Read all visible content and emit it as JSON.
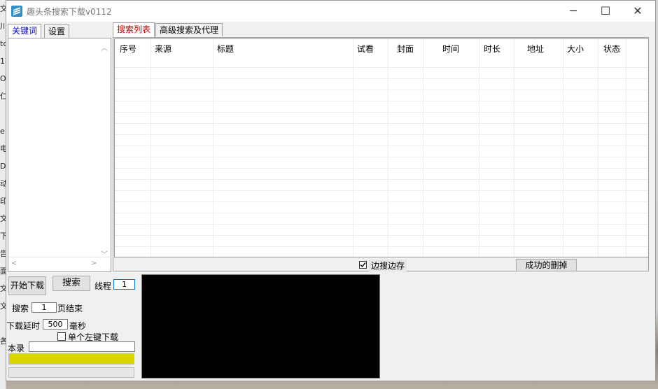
{
  "window": {
    "title": "趣头条搜索下载v0112",
    "controls": {
      "minimize": "─",
      "maximize": "☐",
      "close": "✕"
    }
  },
  "left_tabs": [
    {
      "label": "关键词",
      "active": true,
      "color": "#0000cc"
    },
    {
      "label": "设置",
      "active": false
    }
  ],
  "right_tabs": [
    {
      "label": "搜索列表",
      "active": true,
      "color": "#cc0000"
    },
    {
      "label": "高级搜索及代理",
      "active": false
    }
  ],
  "table": {
    "columns": [
      "序号",
      "来源",
      "标题",
      "试看",
      "封面",
      "时间",
      "时长",
      "地址",
      "大小",
      "状态"
    ]
  },
  "below_table": {
    "checkbox_label": "边搜边存",
    "checkbox_checked": true,
    "delete_success_button": "成功的删掉"
  },
  "controls": {
    "start_download": "开始下载",
    "search": "搜索",
    "threads_label": "线程",
    "threads_value": "1",
    "search_label": "搜索",
    "pages_value": "1",
    "pages_suffix": "页结束",
    "delay_label": "下载延时",
    "delay_value": "500",
    "delay_unit": "毫秒",
    "single_left_click_label": "单个左键下载",
    "record_label": "本录",
    "record_value": "",
    "progress_percent": 100
  },
  "edge_fragments": [
    "文",
    "川",
    "tc",
    "18",
    "O",
    "仁",
    "",
    "e",
    "电",
    "D",
    "动",
    "印",
    "文",
    "下",
    "告",
    "面",
    "文",
    "文",
    "",
    "各"
  ],
  "colors": {
    "progress": "#dcd400"
  }
}
